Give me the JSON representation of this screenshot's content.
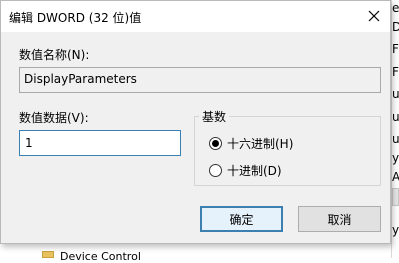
{
  "dialog": {
    "title": "编辑 DWORD (32 位)值",
    "name_label": "数值名称(N):",
    "name_value": "DisplayParameters",
    "data_label": "数值数据(V):",
    "data_value": "1",
    "base": {
      "title": "基数",
      "options": [
        {
          "label": "十六进制(H)",
          "selected": true
        },
        {
          "label": "十进制(D)",
          "selected": false
        }
      ]
    },
    "buttons": {
      "ok": "确定",
      "cancel": "取消"
    }
  },
  "background": {
    "right_chars": [
      "e",
      "D",
      "F",
      "F",
      "u",
      "u",
      "u",
      "y",
      "A",
      "y"
    ],
    "bottom_text": "Device Control"
  },
  "colors": {
    "accent": "#3c7fb1",
    "dialog_bg": "#f0f0f0"
  }
}
